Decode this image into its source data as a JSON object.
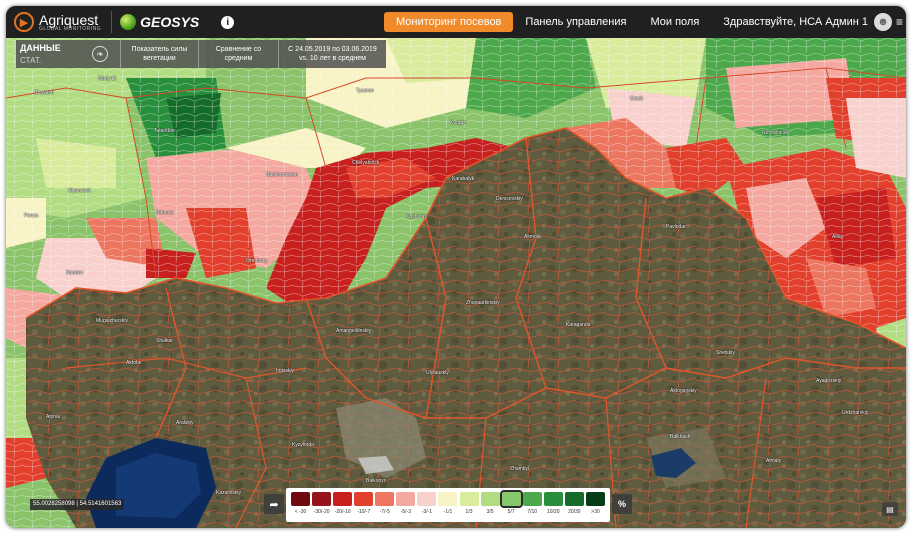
{
  "header": {
    "logo_primary": "Agriquest",
    "logo_primary_sub": "GLOBAL MONITORING",
    "logo_secondary": "GEOSYS",
    "info_icon": "info-icon",
    "nav": [
      {
        "label": "Мониторинг посевов",
        "active": true
      },
      {
        "label": "Панель управления",
        "active": false
      },
      {
        "label": "Мои поля",
        "active": false
      }
    ],
    "greeting": "Здравствуйте, НСА Админ 1",
    "avatar_icon": "user-avatar-icon",
    "menu_icon": "menu-icon"
  },
  "data_panel": {
    "title": "ДАННЫЕ",
    "subtitle": "СТАТ.",
    "leaf_icon": "leaf-icon",
    "indicator": "Показатель силы вегетации",
    "comparison": "Сравнение со средним",
    "period": "С 24.05.2019 по 03.06.2019 vs. 10 лет в среднем"
  },
  "coords": "55.0028258098 | 54.5141601563",
  "legend": {
    "selected": "5/7",
    "items": [
      {
        "label": "< -30",
        "color": "#6e0a10"
      },
      {
        "label": "-30/-20",
        "color": "#961319"
      },
      {
        "label": "-20/-10",
        "color": "#c8201f"
      },
      {
        "label": "-10/-7",
        "color": "#e2402c"
      },
      {
        "label": "-7/-5",
        "color": "#ec7660"
      },
      {
        "label": "-5/-3",
        "color": "#f4a8a0"
      },
      {
        "label": "-3/-1",
        "color": "#f8d0cc"
      },
      {
        "label": "-1/1",
        "color": "#f7f3c4"
      },
      {
        "label": "1/3",
        "color": "#d9ec9c"
      },
      {
        "label": "3/5",
        "color": "#b1dc82"
      },
      {
        "label": "5/7",
        "color": "#86c76a"
      },
      {
        "label": "7/10",
        "color": "#4ca84b"
      },
      {
        "label": "10/20",
        "color": "#288f3c"
      },
      {
        "label": "20/30",
        "color": "#146b2a"
      },
      {
        "label": ">30",
        "color": "#083e17"
      }
    ],
    "export_icon": "export-icon",
    "percent_label": "%",
    "corner_icon": "layers-icon"
  },
  "map_labels": [
    "Mariy El",
    "Chuvash",
    "Tatarstan",
    "Bashkortostan",
    "Ulyanovsk",
    "Samara",
    "Penza",
    "Saratov",
    "Orenburg",
    "Chelyabinsk",
    "Kurgan",
    "Tyumen",
    "Omsk",
    "Novosibirsk",
    "Altay",
    "Kostanay",
    "Akmola",
    "Pavlodar",
    "Karaganda",
    "Aktobe",
    "Atyrau",
    "Kyzylorda",
    "Zhambyl",
    "Almaty",
    "Balkhash",
    "Shetskiy",
    "Zhanaarkinskiy",
    "Aktogayskiy",
    "Ulytauskiy",
    "Karabalyk",
    "Denisovskiy",
    "Amangeldinskiy",
    "Irgizskiy",
    "Aralskiy",
    "Kazalinskiy",
    "Shalkar",
    "Mugalzharskiy",
    "Baikonyr",
    "Ayagozskiy",
    "Urdzharskiy"
  ]
}
